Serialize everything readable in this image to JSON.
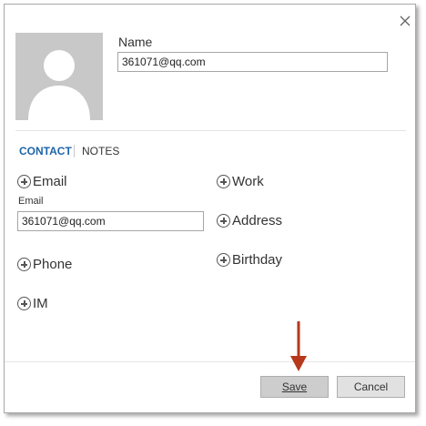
{
  "contact": {
    "name_label": "Name",
    "name_value": "361071@qq.com"
  },
  "tabs": [
    {
      "label": "CONTACT",
      "active": true
    },
    {
      "label": "NOTES",
      "active": false
    }
  ],
  "fields": {
    "email_add_label": "Email",
    "email_field_label": "Email",
    "email_value": "361071@qq.com",
    "phone_add_label": "Phone",
    "im_add_label": "IM",
    "work_add_label": "Work",
    "address_add_label": "Address",
    "birthday_add_label": "Birthday"
  },
  "buttons": {
    "save_label": "Save",
    "cancel_label": "Cancel"
  },
  "colors": {
    "tab_active": "#1e64a8",
    "annotation_arrow": "#b5391a"
  },
  "icons": [
    "close-icon",
    "avatar-placeholder-icon",
    "add-circle-icon",
    "arrow-down-annotation"
  ]
}
